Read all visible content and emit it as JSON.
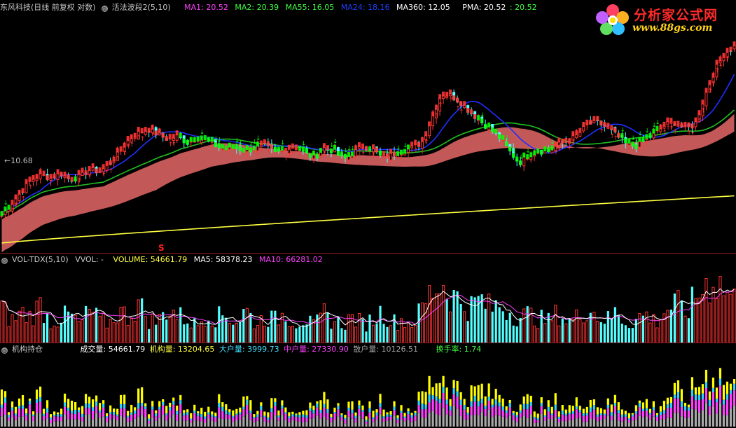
{
  "main_header": {
    "stock": "东风科技(日线 前复权 对数)",
    "indicator": "活法波段2(5,10)",
    "ma1": "MA1: 20.52",
    "ma2": "MA2: 20.39",
    "ma55": "MA55: 16.05",
    "ma24": "MA24: 18.16",
    "ma360": "MA360: 12.05",
    "pma": "PMA: 20.52",
    "pma2": ": 20.52"
  },
  "low_label": "←10.68",
  "s_mark": "S",
  "vol_header": {
    "name": "VOL-TDX(5,10)",
    "vvol": "VVOL: -",
    "volume": "VOLUME: 54661.79",
    "ma5": "MA5: 58378.23",
    "ma10": "MA10: 66281.02"
  },
  "hold_header": {
    "name": "机构持仓",
    "cjl": "成交量: 54661.79",
    "jgl": "机构量: 13204.65",
    "dhl": "大户量: 3999.73",
    "zhl": "中户量: 27330.90",
    "shl": "散户量: 10126.51",
    "hsl": "换手率: 1.74"
  },
  "logo": {
    "title": "分析家公式网",
    "url": "www.88gs.com"
  },
  "colors": {
    "background": "#000000",
    "up": "#ff3333",
    "down": "#54ffff",
    "green_band": "#00ff00",
    "pink_band": "#d46060",
    "ma24": "#2030ff",
    "ma55": "#20c020",
    "ma360": "#ffff40",
    "magenta": "#ff40ff",
    "white": "#ffffff",
    "yellow": "#ffff00"
  },
  "chart_data": {
    "type": "candlestick",
    "main_panel_y_approx": [
      10,
      22
    ],
    "ma360_last": 12.05,
    "ma55_last": 16.05,
    "ma24_last": 18.16,
    "price_low_marked": 10.68,
    "price_profile": [
      10.9,
      11.6,
      12.3,
      13.0,
      13.3,
      13.1,
      13.4,
      13.0,
      13.2,
      13.6,
      13.5,
      13.9,
      14.6,
      15.4,
      15.8,
      16.0,
      15.7,
      15.4,
      15.6,
      15.2,
      15.5,
      15.3,
      15.0,
      14.8,
      14.9,
      14.7,
      14.9,
      15.0,
      14.6,
      14.8,
      15.0,
      14.6,
      14.3,
      14.9,
      14.7,
      14.2,
      14.6,
      15.0,
      14.8,
      14.3,
      14.5,
      14.7,
      14.9,
      15.2,
      16.6,
      18.1,
      18.0,
      17.6,
      17.0,
      16.5,
      16.0,
      15.5,
      14.7,
      14.0,
      14.5,
      14.7,
      14.7,
      15.1,
      15.3,
      15.7,
      16.3,
      16.4,
      16.1,
      15.6,
      15.1,
      15.0,
      15.4,
      15.8,
      16.3,
      16.4,
      16.0,
      16.3,
      18.0,
      19.5,
      20.5,
      20.9
    ],
    "volume_profile": [
      62,
      40,
      55,
      48,
      70,
      38,
      45,
      52,
      33,
      60,
      41,
      36,
      58,
      47,
      72,
      43,
      39,
      65,
      50,
      44,
      31,
      57,
      46,
      52,
      38,
      61,
      34,
      49,
      42,
      55,
      37,
      45,
      30,
      53,
      40,
      36,
      47,
      33,
      44,
      58,
      38,
      42,
      35,
      60,
      95,
      110,
      88,
      75,
      65,
      80,
      62,
      70,
      58,
      48,
      52,
      44,
      40,
      55,
      38,
      47,
      66,
      50,
      42,
      58,
      35,
      45,
      52,
      38,
      60,
      72,
      55,
      80,
      105,
      118,
      96,
      78
    ],
    "volume_ma5_last": 58378.23,
    "volume_ma10_last": 66281.02,
    "volume_last": 54661.79
  }
}
